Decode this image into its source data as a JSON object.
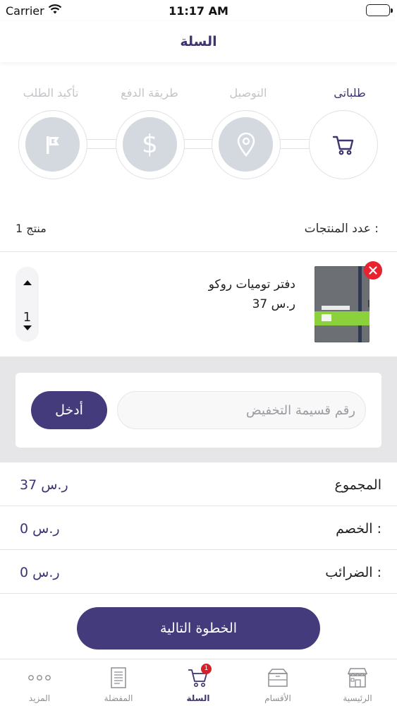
{
  "status_bar": {
    "carrier": "Carrier",
    "time": "11:17 AM"
  },
  "nav": {
    "title": "السلة"
  },
  "stepper": {
    "steps": [
      {
        "label": "طلباتى",
        "icon": "cart-icon",
        "active": true
      },
      {
        "label": "التوصيل",
        "icon": "location-pin-icon",
        "active": false
      },
      {
        "label": "طريقة الدفع",
        "icon": "dollar-icon",
        "active": false
      },
      {
        "label": "تأكيد الطلب",
        "icon": "flag-icon",
        "active": false
      }
    ]
  },
  "product_count": {
    "label": "عدد المنتجات :",
    "value": "1 منتج"
  },
  "cart_items": [
    {
      "name": "دفتر توميات روكو",
      "price": "37 ر.س",
      "quantity": "1"
    }
  ],
  "coupon": {
    "placeholder": "رقم قسيمة التخفيض",
    "apply_label": "أدخل"
  },
  "totals": {
    "subtotal_label": "المجموع",
    "subtotal_value": "37 ر.س",
    "discount_label": "الخصم :",
    "discount_value": "0 ر.س",
    "taxes_label": "الضرائب :",
    "taxes_value": "0 ر.س"
  },
  "next_button": {
    "label": "الخطوة التالية"
  },
  "colors": {
    "primary": "#443b7d",
    "title": "#3d3470",
    "danger": "#e8232f",
    "step_inactive": "#d3d9de"
  },
  "tab_bar": {
    "tabs": [
      {
        "label": "المزيد",
        "icon": "more-dots-icon",
        "active": false
      },
      {
        "label": "المفضلة",
        "icon": "document-list-icon",
        "active": false
      },
      {
        "label": "السلة",
        "icon": "cart-icon",
        "active": true,
        "badge": "1"
      },
      {
        "label": "الأقسام",
        "icon": "box-icon",
        "active": false
      },
      {
        "label": "الرئيسية",
        "icon": "store-icon",
        "active": false
      }
    ]
  }
}
